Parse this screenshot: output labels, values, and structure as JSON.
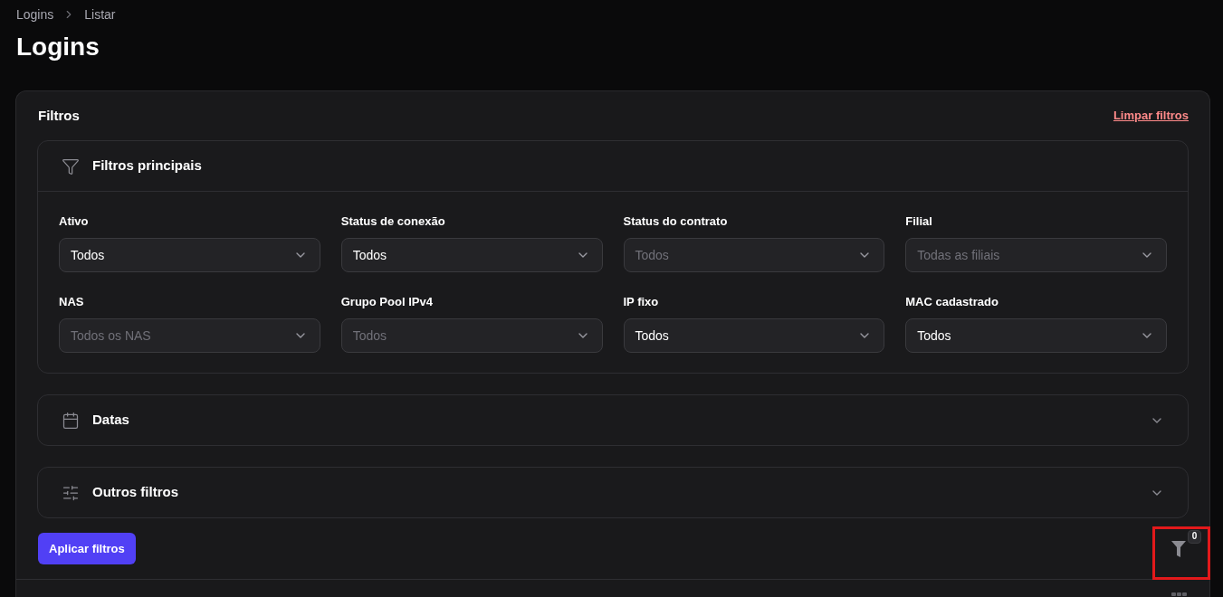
{
  "breadcrumb": [
    "Logins",
    "Listar"
  ],
  "title": "Logins",
  "filters": {
    "title": "Filtros",
    "clear_link": "Limpar filtros",
    "sections": [
      {
        "title": "Filtros principais",
        "kind": "main",
        "expanded": true,
        "fields": [
          {
            "label": "Ativo",
            "value": "Todos"
          },
          {
            "label": "Status de conexão",
            "value": "Todos"
          },
          {
            "label": "Status do contrato",
            "placeholder": "Todos"
          },
          {
            "label": "Filial",
            "placeholder": "Todas as filiais"
          },
          {
            "label": "NAS",
            "placeholder": "Todos os NAS"
          },
          {
            "label": "Grupo Pool IPv4",
            "placeholder": "Todos"
          },
          {
            "label": "IP fixo",
            "value": "Todos"
          },
          {
            "label": "MAC cadastrado",
            "value": "Todos"
          }
        ]
      },
      {
        "title": "Datas",
        "kind": "dates",
        "expanded": false
      },
      {
        "title": "Outros filtros",
        "kind": "other",
        "expanded": false
      }
    ],
    "apply_button": "Aplicar filtros",
    "active_count": "0"
  }
}
